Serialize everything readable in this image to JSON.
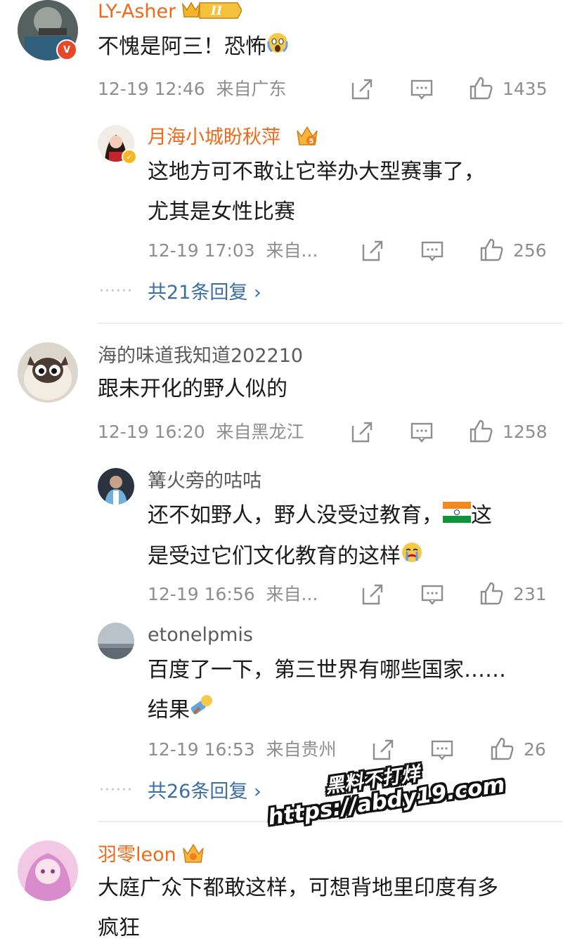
{
  "comments": [
    {
      "user": "LY-Asher",
      "badge": "II",
      "text": "不愧是阿三！恐怖",
      "time": "12-19 12:46",
      "location": "来自广东",
      "likes": "1435",
      "replies": [
        {
          "user": "月海小城盼秋萍",
          "badge": "5",
          "text_line1": "这地方可不敢让它举办大型赛事了，",
          "text_line2": "尤其是女性比赛",
          "time": "12-19 17:03",
          "location": "来自...",
          "likes": "256"
        }
      ],
      "more_replies": "共21条回复"
    },
    {
      "user": "海的味道我知道202210",
      "text": "跟未开化的野人似的",
      "time": "12-19 16:20",
      "location": "来自黑龙江",
      "likes": "1258",
      "replies": [
        {
          "user": "篝火旁的咕咕",
          "text_line1a": "还不如野人，野人没受过教育，",
          "text_line1b": "这",
          "text_line2": "是受过它们文化教育的这样",
          "time": "12-19 16:56",
          "location": "来自...",
          "likes": "231"
        },
        {
          "user": "etonelpmis",
          "text_line1": "百度了一下，第三世界有哪些国家……",
          "text_line2": "结果",
          "time": "12-19 16:53",
          "location": "来自贵州",
          "likes": "26"
        }
      ],
      "more_replies": "共26条回复"
    },
    {
      "user": "羽零leon",
      "text_line1": "大庭广众下都敢这样，可想背地里印度有多",
      "text_line2": "疯狂"
    }
  ],
  "ui": {
    "v_badge": "V",
    "check_mark": "✓",
    "dots": "······",
    "chevron": "›"
  },
  "watermark": {
    "line1": "黑料不打烊",
    "line2": "https://abdy19.com"
  },
  "colors": {
    "vip_name": "#ee6a1a",
    "link": "#3a6ea5",
    "meta": "#8e8e8e",
    "divider": "#eeeeee"
  }
}
